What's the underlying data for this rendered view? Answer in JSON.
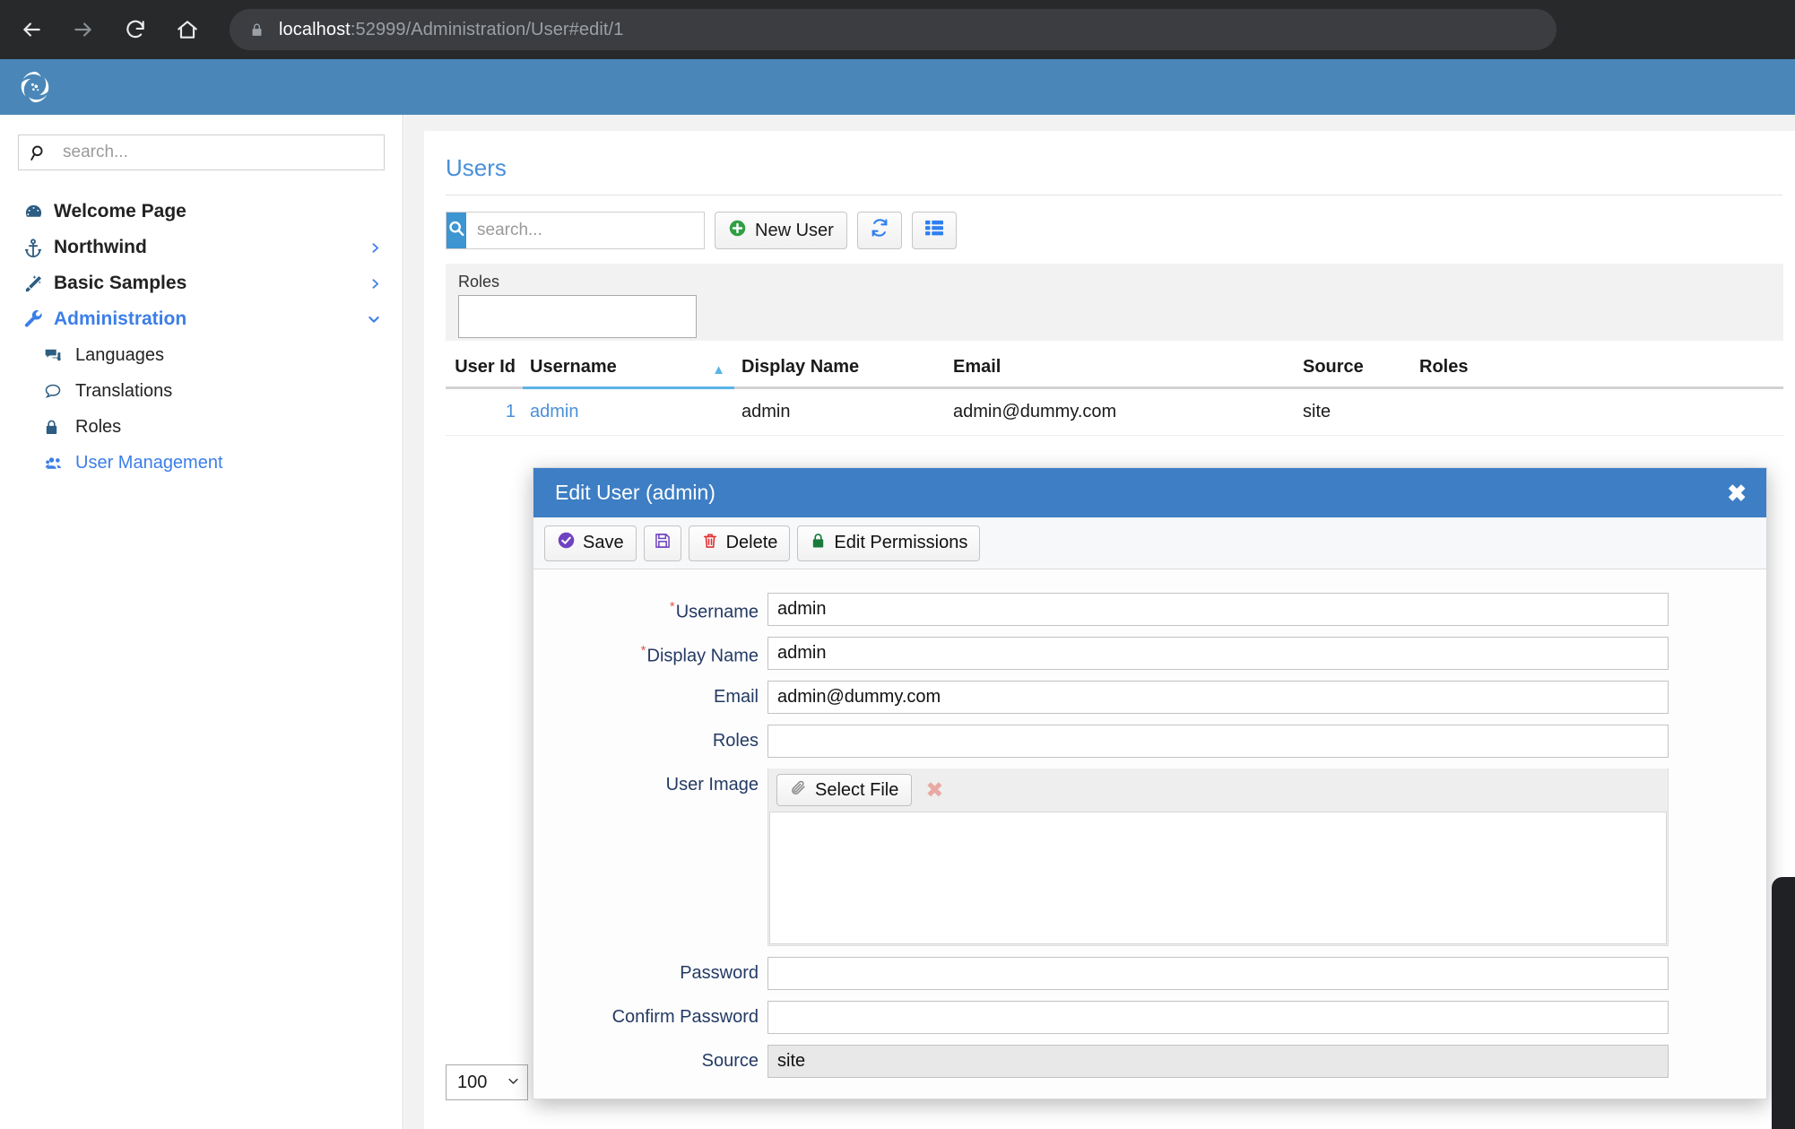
{
  "browser": {
    "url_host": "localhost",
    "url_rest": ":52999/Administration/User#edit/1",
    "back_icon": "back-arrow-icon",
    "forward_icon": "forward-arrow-icon",
    "reload_icon": "reload-icon",
    "home_icon": "home-icon",
    "lock_icon": "lock-icon"
  },
  "header": {
    "logo_icon": "swirl-logo-icon"
  },
  "sidebar": {
    "search_placeholder": "search...",
    "search_value": "",
    "search_icon": "search-icon",
    "items": [
      {
        "label": "Welcome Page",
        "icon": "dashboard-icon",
        "level": 0,
        "chevron": "",
        "active": false
      },
      {
        "label": "Northwind",
        "icon": "anchor-icon",
        "level": 0,
        "chevron": "chevron-right-icon",
        "active": false
      },
      {
        "label": "Basic Samples",
        "icon": "magic-wand-icon",
        "level": 0,
        "chevron": "chevron-right-icon",
        "active": false
      },
      {
        "label": "Administration",
        "icon": "wrench-icon",
        "level": 0,
        "chevron": "chevron-down-icon",
        "active": true
      },
      {
        "label": "Languages",
        "icon": "comments-icon",
        "level": 1,
        "chevron": "",
        "active": false
      },
      {
        "label": "Translations",
        "icon": "comment-icon",
        "level": 1,
        "chevron": "",
        "active": false
      },
      {
        "label": "Roles",
        "icon": "lock-icon",
        "level": 1,
        "chevron": "",
        "active": false
      },
      {
        "label": "User Management",
        "icon": "users-icon",
        "level": 1,
        "chevron": "",
        "active": true
      }
    ]
  },
  "main": {
    "page_title": "Users",
    "toolbar": {
      "search_placeholder": "search...",
      "search_value": "",
      "search_icon": "search-icon",
      "new_user_label": "New User",
      "new_user_icon": "plus-circle-icon",
      "refresh_icon": "refresh-icon",
      "columns_icon": "column-picker-icon"
    },
    "filter": {
      "roles_label": "Roles",
      "roles_value": ""
    },
    "table": {
      "columns": [
        {
          "key": "user_id",
          "label": "User Id",
          "align": "right",
          "sorted": false
        },
        {
          "key": "username",
          "label": "Username",
          "align": "left",
          "sorted": true,
          "sort_dir": "asc"
        },
        {
          "key": "display_name",
          "label": "Display Name",
          "align": "left",
          "sorted": false
        },
        {
          "key": "email",
          "label": "Email",
          "align": "left",
          "sorted": false
        },
        {
          "key": "source",
          "label": "Source",
          "align": "left",
          "sorted": false
        },
        {
          "key": "roles",
          "label": "Roles",
          "align": "left",
          "sorted": false
        }
      ],
      "rows": [
        {
          "user_id": "1",
          "username": "admin",
          "display_name": "admin",
          "email": "admin@dummy.com",
          "source": "site",
          "roles": ""
        }
      ]
    },
    "page_size": "100",
    "page_size_caret": "chevron-down-icon"
  },
  "modal": {
    "title": "Edit User (admin)",
    "close_icon": "close-icon",
    "toolbar": {
      "save_label": "Save",
      "save_icon": "check-circle-icon",
      "save_as_icon": "floppy-disk-icon",
      "delete_label": "Delete",
      "delete_icon": "trash-icon",
      "permissions_label": "Edit Permissions",
      "permissions_icon": "lock-icon"
    },
    "fields": {
      "username": {
        "label": "Username",
        "value": "admin",
        "required": true
      },
      "display_name": {
        "label": "Display Name",
        "value": "admin",
        "required": true
      },
      "email": {
        "label": "Email",
        "value": "admin@dummy.com",
        "required": false
      },
      "roles": {
        "label": "Roles",
        "value": "",
        "required": false
      },
      "user_image": {
        "label": "User Image",
        "select_file_label": "Select File",
        "select_file_icon": "paperclip-icon",
        "clear_icon": "clear-x-icon"
      },
      "password": {
        "label": "Password",
        "value": "",
        "required": false
      },
      "confirm_password": {
        "label": "Confirm Password",
        "value": "",
        "required": false
      },
      "source": {
        "label": "Source",
        "value": "site",
        "required": false,
        "readonly": true
      }
    }
  },
  "colors": {
    "brand_header": "#4a87b8",
    "accent_link": "#4a90d9",
    "modal_header": "#3d7ec4",
    "active_nav": "#3c7ee8",
    "search_btn": "#3d95d1",
    "required_star": "#e05a4f"
  }
}
